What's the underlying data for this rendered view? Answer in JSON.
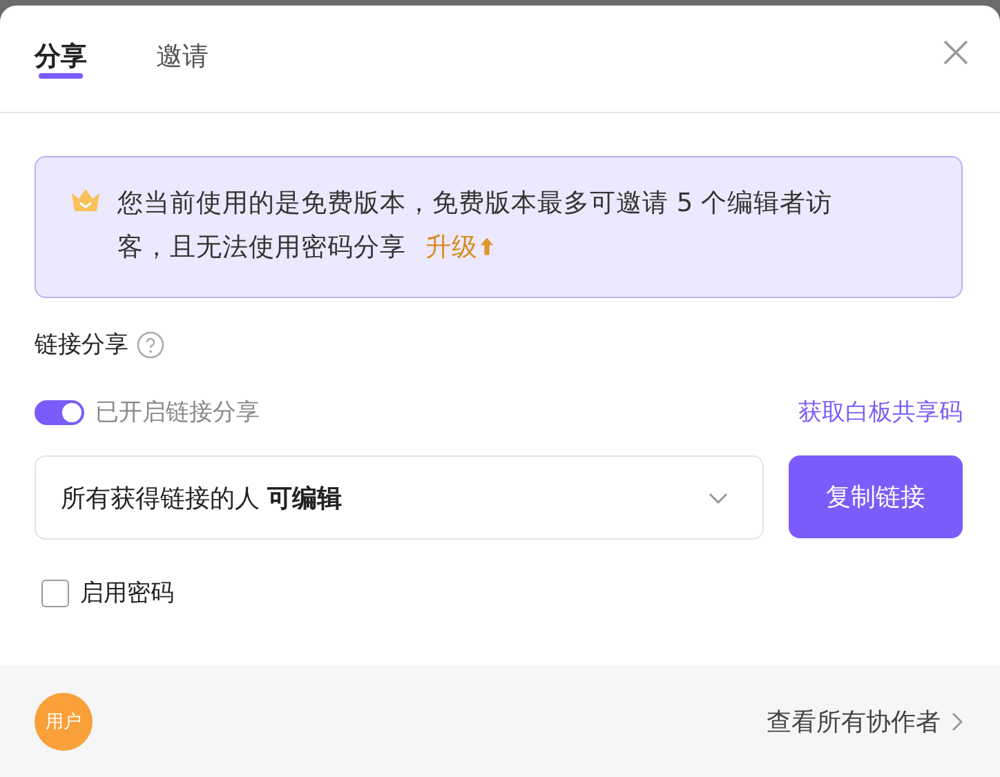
{
  "dialog": {
    "tabs": [
      {
        "label": "分享",
        "selected": true
      },
      {
        "label": "邀请",
        "selected": false
      }
    ],
    "notice": {
      "text": "您当前使用的是免费版本，免费版本最多可邀请 5 个编辑者访客，且无法使用密码分享",
      "link": "升级"
    },
    "section_title": "链接分享",
    "link_sharing": {
      "label": "已开启链接分享",
      "on": true
    },
    "share_code_link": "获取白板共享码",
    "permission_select": {
      "value": "所有获得链接的人 **可编辑**"
    },
    "copy_button": "复制链接",
    "password": {
      "label": "启用密码",
      "checked": false
    },
    "footer": {
      "avatar": "用户",
      "view_all": "查看所有协作者"
    }
  }
}
